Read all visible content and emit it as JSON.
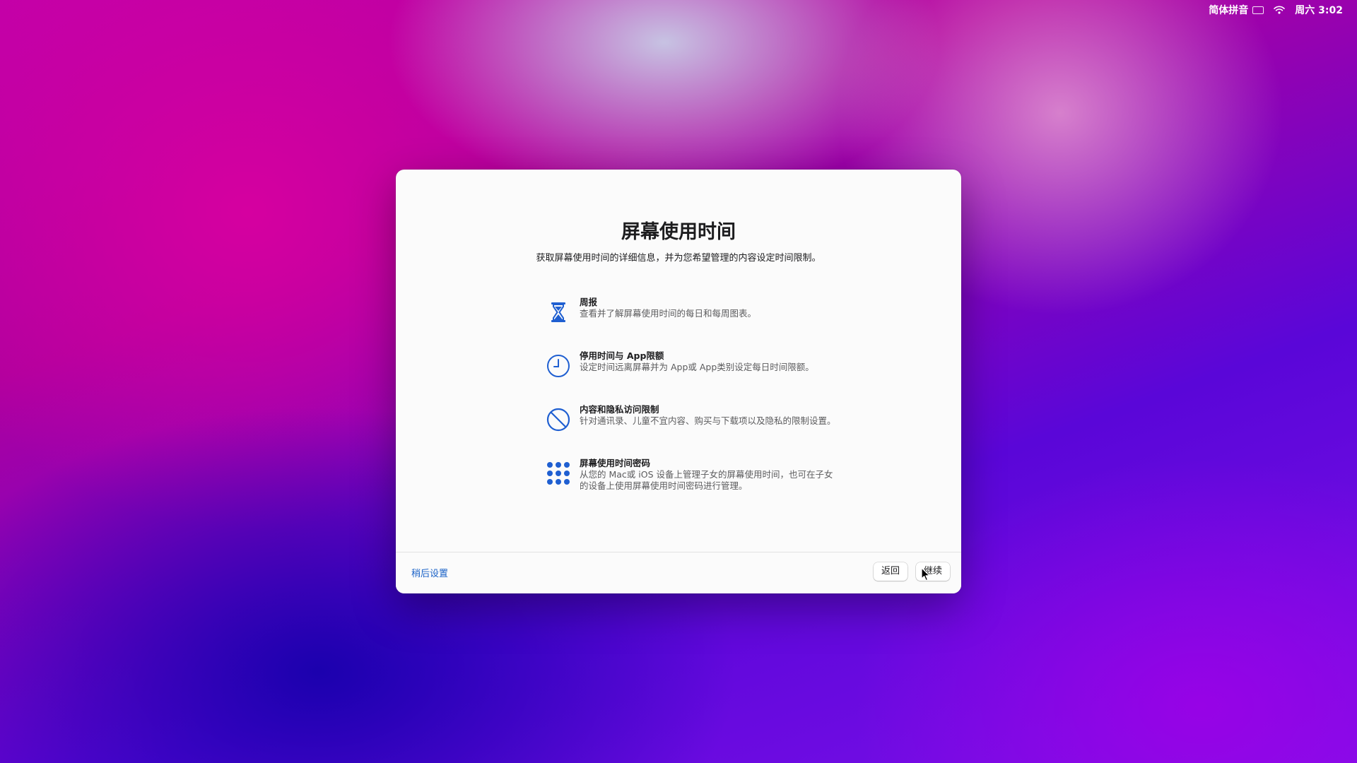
{
  "menubar": {
    "input_method": "简体拼音",
    "clock": "周六 3:02"
  },
  "dialog": {
    "title": "屏幕使用时间",
    "subtitle": "获取屏幕使用时间的详细信息，并为您希望管理的内容设定时间限制。",
    "features": [
      {
        "icon": "hourglass-icon",
        "title": "周报",
        "desc": "查看并了解屏幕使用时间的每日和每周图表。"
      },
      {
        "icon": "clock-icon",
        "title": "停用时间与 App限额",
        "desc": "设定时间远离屏幕并为 App或 App类别设定每日时间限额。"
      },
      {
        "icon": "prohibited-icon",
        "title": "内容和隐私访问限制",
        "desc": "针对通讯录、儿童不宜内容、购买与下载项以及隐私的限制设置。"
      },
      {
        "icon": "keypad-icon",
        "title": "屏幕使用时间密码",
        "desc": "从您的 Mac或 iOS 设备上管理子女的屏幕使用时间，也可在子女的设备上使用屏幕使用时间密码进行管理。"
      }
    ],
    "footer": {
      "later_label": "稍后设置",
      "back_label": "返回",
      "continue_label": "继续"
    }
  },
  "colors": {
    "accent": "#1a62c7",
    "icon_blue": "#1f5fd1"
  }
}
